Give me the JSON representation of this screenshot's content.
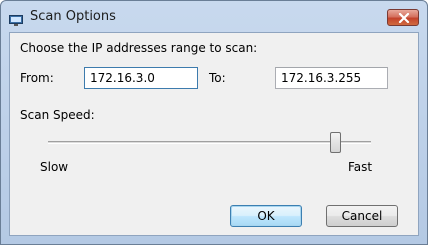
{
  "window": {
    "title": "Scan Options",
    "icon": "monitor-icon",
    "close_icon": "close-icon"
  },
  "range": {
    "heading": "Choose the IP addresses range to scan:",
    "from_label": "From:",
    "from_value": "172.16.3.0",
    "to_label": "To:",
    "to_value": "172.16.3.255"
  },
  "speed": {
    "label": "Scan Speed:",
    "min_label": "Slow",
    "max_label": "Fast",
    "level": 0.89
  },
  "buttons": {
    "ok_label": "OK",
    "cancel_label": "Cancel"
  },
  "colors": {
    "accent": "#3c7fb1",
    "close_red": "#c4432c"
  }
}
